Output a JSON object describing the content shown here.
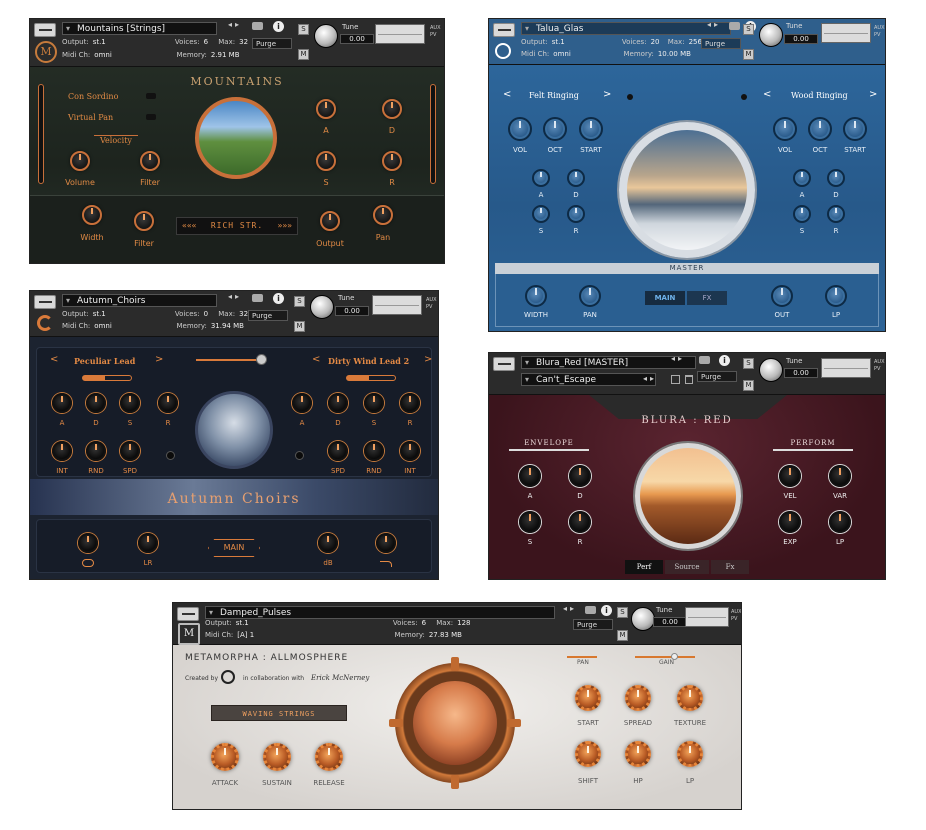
{
  "mountains": {
    "name": "Mountains [Strings]",
    "logo": "M",
    "output_label": "Output:",
    "output_value": "st.1",
    "voices_label": "Voices:",
    "voices_value": "6",
    "max_label": "Max:",
    "max_value": "32",
    "midi_label": "Midi Ch:",
    "midi_value": "omni",
    "memory_label": "Memory:",
    "memory_value": "2.91 MB",
    "purge": "Purge",
    "tune_label": "Tune",
    "tune_value": "0.00",
    "title": "MOUNTAINS",
    "toggles": [
      "Con Sordino",
      "Virtual Pan"
    ],
    "velocity": "Velocity",
    "knob_labels": [
      "Volume",
      "Filter",
      "A",
      "D",
      "S",
      "R",
      "Width",
      "Filter",
      "Output",
      "Pan"
    ],
    "preset": "RICH STR.",
    "preset_prev": "«««",
    "preset_next": "»»»",
    "accent": "#c8703a"
  },
  "talua": {
    "name": "Talua_Glas",
    "output_label": "Output:",
    "output_value": "st.1",
    "voices_label": "Voices:",
    "voices_value": "20",
    "max_label": "Max:",
    "max_value": "256",
    "midi_label": "Midi Ch:",
    "midi_value": "omni",
    "memory_label": "Memory:",
    "memory_value": "10.00 MB",
    "purge": "Purge",
    "tune_label": "Tune",
    "tune_value": "0.00",
    "left_layer": "Felt Ringing",
    "right_layer": "Wood Ringing",
    "prev": "<",
    "next": ">",
    "left_knobs": [
      "VOL",
      "OCT",
      "START"
    ],
    "right_knobs": [
      "VOL",
      "OCT",
      "START"
    ],
    "adsr": [
      "A",
      "D",
      "S",
      "R"
    ],
    "master": "MASTER",
    "tabs": [
      "MAIN",
      "FX"
    ],
    "bottom_knobs": [
      "WIDTH",
      "PAN",
      "OUT",
      "LP"
    ],
    "accent": "#2f6aa0"
  },
  "autumn": {
    "name": "Autumn_Choirs",
    "output_label": "Output:",
    "output_value": "st.1",
    "voices_label": "Voices:",
    "voices_value": "0",
    "max_label": "Max:",
    "max_value": "32",
    "midi_label": "Midi Ch:",
    "midi_value": "omni",
    "memory_label": "Memory:",
    "memory_value": "31.94 MB",
    "purge": "Purge",
    "tune_label": "Tune",
    "tune_value": "0.00",
    "left_layer": "Peculiar Lead",
    "right_layer": "Dirty Wind Lead 2",
    "prev": "<",
    "next": ">",
    "adsr": [
      "A",
      "D",
      "S",
      "R"
    ],
    "left_row2": [
      "INT",
      "RND",
      "SPD"
    ],
    "right_row2": [
      "SPD",
      "RND",
      "INT"
    ],
    "title": "Autumn Choirs",
    "main": "MAIN",
    "bottom_labels": [
      "LR",
      "dB"
    ],
    "accent": "#d97a3a"
  },
  "blura": {
    "name": "Blura_Red [MASTER]",
    "snapshot": "Can't_Escape",
    "purge": "Purge",
    "tune_label": "Tune",
    "tune_value": "0.00",
    "title": "BLURA : RED",
    "envelope": "ENVELOPE",
    "perform": "PERFORM",
    "env_knobs": [
      "A",
      "D",
      "S",
      "R"
    ],
    "perf_knobs": [
      "VEL",
      "VAR",
      "EXP",
      "LP"
    ],
    "tabs": [
      "Perf",
      "Source",
      "Fx"
    ],
    "accent": "#4a1a22"
  },
  "damped": {
    "name": "Damped_Pulses",
    "output_label": "Output:",
    "output_value": "st.1",
    "voices_label": "Voices:",
    "voices_value": "6",
    "max_label": "Max:",
    "max_value": "128",
    "midi_label": "Midi Ch:",
    "midi_value": "[A] 1",
    "memory_label": "Memory:",
    "memory_value": "27.83 MB",
    "purge": "Purge",
    "tune_label": "Tune",
    "tune_value": "0.00",
    "title": "METAMORPHA : ALLMOSPHERE",
    "created_by": "Created by",
    "collab": "in collaboration with",
    "artist": "Erick McNerney",
    "preset": "WAVING STRINGS",
    "left_knobs": [
      "ATTACK",
      "SUSTAIN",
      "RELEASE"
    ],
    "right_top": [
      "PAN",
      "GAIN"
    ],
    "right_knobs": [
      "START",
      "SPREAD",
      "TEXTURE",
      "SHIFT",
      "HP",
      "LP"
    ],
    "accent": "#d8782f"
  }
}
